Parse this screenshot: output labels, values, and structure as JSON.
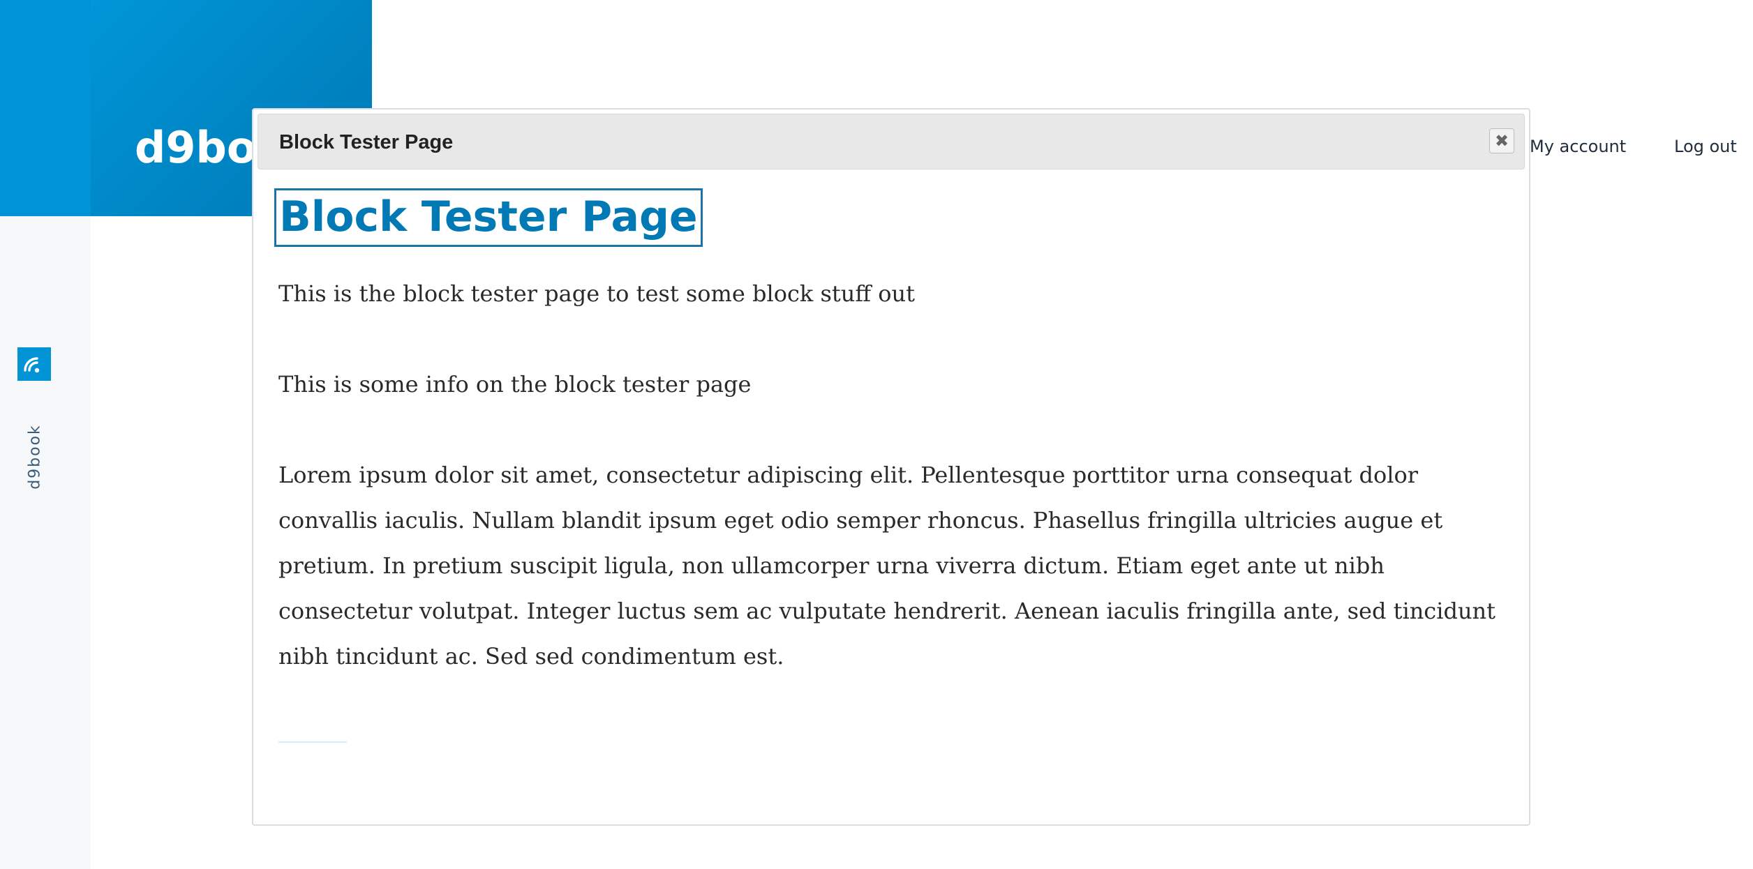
{
  "site": {
    "brand_name": "d9book",
    "vertical_label": "d9book"
  },
  "nav": {
    "my_account": "My account",
    "log_out": "Log out"
  },
  "dialog": {
    "title": "Block Tester Page",
    "close_label": "✖",
    "heading": "Block Tester Page",
    "paragraphs": [
      "This is the block tester page to test some block stuff out",
      "This is some info on the block tester page",
      "Lorem ipsum dolor sit amet, consectetur adipiscing elit. Pellentesque porttitor urna consequat dolor convallis iaculis. Nullam blandit ipsum eget odio semper rhoncus. Phasellus fringilla ultricies augue et pretium. In pretium suscipit ligula, non ullamcorper urna viverra dictum. Etiam eget ante ut nibh consectetur volutpat. Integer luctus sem ac vulputate hendrerit. Aenean iaculis fringilla ante, sed tincidunt nibh tincidunt ac. Sed sed condimentum est."
    ]
  },
  "colors": {
    "brand_blue": "#0093d6",
    "heading_blue": "#0079b4",
    "focus_outline": "#1d72a8"
  },
  "icons": {
    "rss": "rss-feed-icon",
    "close": "close-icon"
  }
}
